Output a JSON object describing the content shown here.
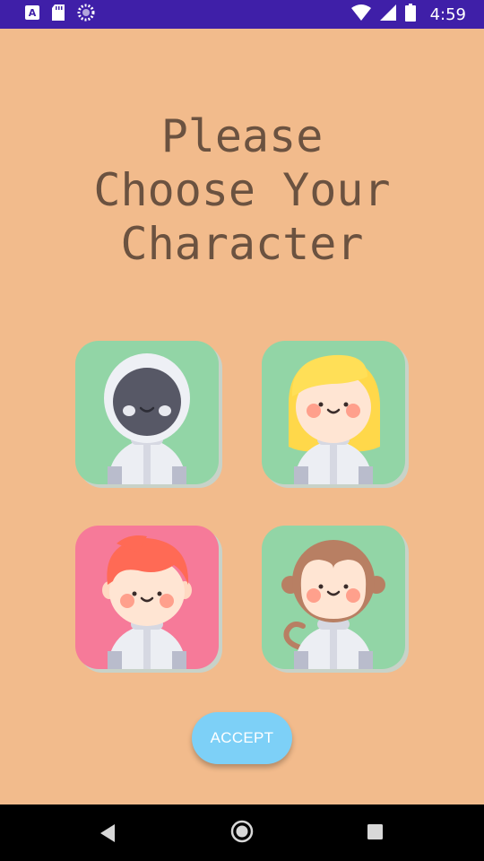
{
  "status_bar": {
    "time": "4:59",
    "left_icons": [
      "font-download-icon",
      "sd-card-icon",
      "loading-spinner-icon"
    ],
    "right_icons": [
      "wifi-icon",
      "cell-signal-icon",
      "battery-icon"
    ]
  },
  "title_lines": [
    "Please",
    "Choose Your",
    "Character"
  ],
  "characters": [
    {
      "name": "astronaut-robot",
      "background": "#92d5a6"
    },
    {
      "name": "astronaut-blonde-girl",
      "background": "#92d5a6"
    },
    {
      "name": "astronaut-redhead-boy",
      "background": "#f67a99"
    },
    {
      "name": "astronaut-monkey",
      "background": "#92d5a6"
    }
  ],
  "accept_label": "ACCEPT",
  "colors": {
    "background": "#f2bb8c",
    "status_bar": "#3f1fa8",
    "title_text": "#6b5240",
    "accept_button": "#7dd0f7"
  },
  "nav_bar": {
    "buttons": [
      "back",
      "home",
      "recents"
    ]
  }
}
